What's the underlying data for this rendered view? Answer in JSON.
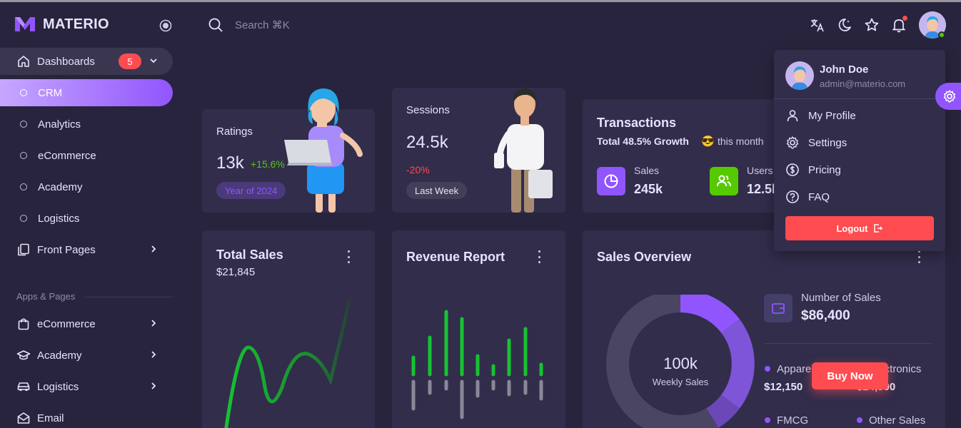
{
  "brand": {
    "name": "MATERIO"
  },
  "sidebar": {
    "dashboards": {
      "label": "Dashboards",
      "badge": "5"
    },
    "sub_items": [
      "CRM",
      "Analytics",
      "eCommerce",
      "Academy",
      "Logistics"
    ],
    "front_pages": "Front Pages",
    "section_label": "Apps & Pages",
    "apps": [
      "eCommerce",
      "Academy",
      "Logistics",
      "Email"
    ]
  },
  "search": {
    "placeholder": "Search ⌘K"
  },
  "cards": {
    "ratings": {
      "title": "Ratings",
      "value": "13k",
      "change": "+15.6%",
      "chip": "Year of 2024"
    },
    "sessions": {
      "title": "Sessions",
      "value": "24.5k",
      "change": "-20%",
      "chip": "Last Week"
    },
    "transactions": {
      "title": "Transactions",
      "subtitle_bold": "Total 48.5% Growth",
      "subtitle_rest": "this month",
      "emoji": "😎",
      "stats": [
        {
          "label": "Sales",
          "value": "245k"
        },
        {
          "label": "Users",
          "value": "12.5k"
        }
      ]
    },
    "total_sales": {
      "title": "Total Sales",
      "value": "$21,845"
    },
    "revenue_report": {
      "title": "Revenue Report"
    },
    "sales_overview": {
      "title": "Sales Overview",
      "donut_value": "100k",
      "donut_label": "Weekly Sales",
      "number_label": "Number of Sales",
      "number_value": "$86,400",
      "legend": [
        {
          "label": "Apparel",
          "value": "$12,150"
        },
        {
          "label": "Electronics",
          "value": "$24,900"
        },
        {
          "label": "FMCG",
          "value": ""
        },
        {
          "label": "Other Sales",
          "value": ""
        }
      ]
    }
  },
  "profile_menu": {
    "name": "John Doe",
    "email": "admin@materio.com",
    "items": [
      "My Profile",
      "Settings",
      "Pricing",
      "FAQ"
    ],
    "logout": "Logout"
  },
  "buy_now": "Buy Now",
  "colors": {
    "primary": "#9155fd",
    "success": "#56ca00",
    "danger": "#ff4c51",
    "card": "#312d4b",
    "bg": "#28243d"
  }
}
